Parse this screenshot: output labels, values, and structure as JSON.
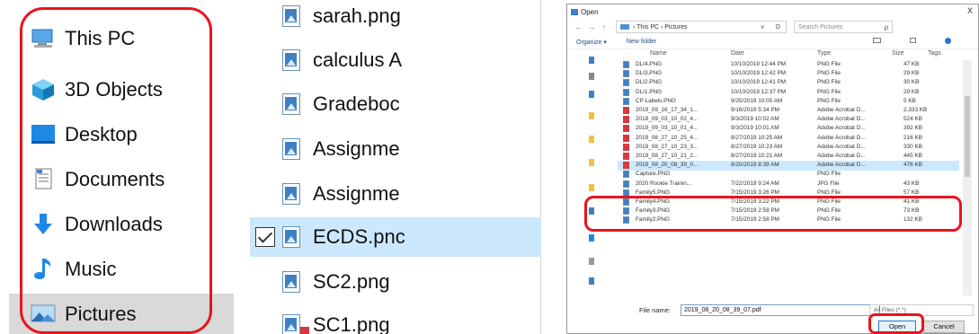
{
  "left": {
    "nav_items": [
      {
        "label": "This PC",
        "icon": "computer-icon"
      },
      {
        "label": "3D Objects",
        "icon": "cube-3d-icon"
      },
      {
        "label": "Desktop",
        "icon": "desktop-icon"
      },
      {
        "label": "Documents",
        "icon": "documents-icon"
      },
      {
        "label": "Downloads",
        "icon": "download-arrow-icon"
      },
      {
        "label": "Music",
        "icon": "music-note-icon"
      },
      {
        "label": "Pictures",
        "icon": "pictures-icon",
        "selected": true
      }
    ],
    "files": [
      {
        "label": "sarah.png"
      },
      {
        "label": "calculus A"
      },
      {
        "label": "Gradeboc"
      },
      {
        "label": "Assignme"
      },
      {
        "label": "Assignme"
      },
      {
        "label": "ECDS.pnc",
        "selected": true,
        "checked": true
      },
      {
        "label": "SC2.png"
      },
      {
        "label": "SC1.png"
      }
    ]
  },
  "dialog": {
    "title": "Open",
    "close_glyph": "X",
    "nav_back": "←",
    "nav_forward": "→",
    "nav_up": "↑",
    "breadcrumb": "› This PC › Pictures",
    "address_dropdown": "v",
    "refresh": "ʘ",
    "search_placeholder": "Search Pictures",
    "search_glyph": "ρ",
    "organize": "Organize ▾",
    "new_folder": "New folder",
    "columns": {
      "name": "Name",
      "date": "Date",
      "type": "Type",
      "size": "Size",
      "tags": "Tags"
    },
    "rows": [
      {
        "name": "DLI4.PNG",
        "date": "10/10/2019 12:44 PM",
        "type": "PNG File",
        "size": "47 KB",
        "kind": "png"
      },
      {
        "name": "DLI3.PNG",
        "date": "10/10/2019 12:42 PM",
        "type": "PNG File",
        "size": "29 KB",
        "kind": "png"
      },
      {
        "name": "DLI2.PNG",
        "date": "10/10/2019 12:41 PM",
        "type": "PNG File",
        "size": "30 KB",
        "kind": "png"
      },
      {
        "name": "DLI1.PNG",
        "date": "10/10/2019 12:37 PM",
        "type": "PNG File",
        "size": "29 KB",
        "kind": "png"
      },
      {
        "name": "CP Labels.PNG",
        "date": "9/25/2019 10:05 AM",
        "type": "PNG File",
        "size": "5 KB",
        "kind": "png"
      },
      {
        "name": "2019_09_16_17_34_1...",
        "date": "9/16/2019 5:34 PM",
        "type": "Adobe Acrobat D...",
        "size": "2,333 KB",
        "kind": "pdf"
      },
      {
        "name": "2019_09_03_10_02_4...",
        "date": "9/3/2019 10:02 AM",
        "type": "Adobe Acrobat D...",
        "size": "524 KB",
        "kind": "pdf"
      },
      {
        "name": "2019_09_03_10_01_4...",
        "date": "9/3/2019 10:01 AM",
        "type": "Adobe Acrobat D...",
        "size": "392 KB",
        "kind": "pdf"
      },
      {
        "name": "2019_08_27_10_25_4...",
        "date": "8/27/2019 10:25 AM",
        "type": "Adobe Acrobat D...",
        "size": "216 KB",
        "kind": "pdf"
      },
      {
        "name": "2019_08_27_10_23_3...",
        "date": "8/27/2019 10:23 AM",
        "type": "Adobe Acrobat D...",
        "size": "330 KB",
        "kind": "pdf"
      },
      {
        "name": "2019_08_27_10_21_2...",
        "date": "8/27/2019 10:21 AM",
        "type": "Adobe Acrobat D...",
        "size": "445 KB",
        "kind": "pdf"
      },
      {
        "name": "2019_08_20_08_39_0...",
        "date": "8/20/2019 8:39 AM",
        "type": "Adobe Acrobat D...",
        "size": "476 KB",
        "kind": "pdf",
        "selected": true
      },
      {
        "name": "Capture.PNG",
        "date": "",
        "type": "PNG File",
        "size": "",
        "kind": "png"
      },
      {
        "name": "2020 Rookie Trainin...",
        "date": "7/22/2019 9:24 AM",
        "type": "JPG File",
        "size": "43 KB",
        "kind": "png"
      },
      {
        "name": "Family5.PNG",
        "date": "7/15/2019 3:26 PM",
        "type": "PNG File",
        "size": "57 KB",
        "kind": "png"
      },
      {
        "name": "Family4.PNG",
        "date": "7/15/2019 3:22 PM",
        "type": "PNG File",
        "size": "41 KB",
        "kind": "png"
      },
      {
        "name": "Family3.PNG",
        "date": "7/15/2019 2:58 PM",
        "type": "PNG File",
        "size": "73 KB",
        "kind": "png"
      },
      {
        "name": "Family2.PNG",
        "date": "7/15/2019 2:58 PM",
        "type": "PNG File",
        "size": "132 KB",
        "kind": "png"
      }
    ],
    "file_name_label": "File name:",
    "file_name_value": "2019_08_20_08_39_07.pdf",
    "file_type": "All Files (*.*)",
    "open_label": "Open",
    "cancel_label": "Cancel"
  },
  "colors": {
    "highlight": "#e8141f",
    "selection": "#cce8ff",
    "nav_selected": "#d9d9d9",
    "accent": "#3f80c4"
  }
}
